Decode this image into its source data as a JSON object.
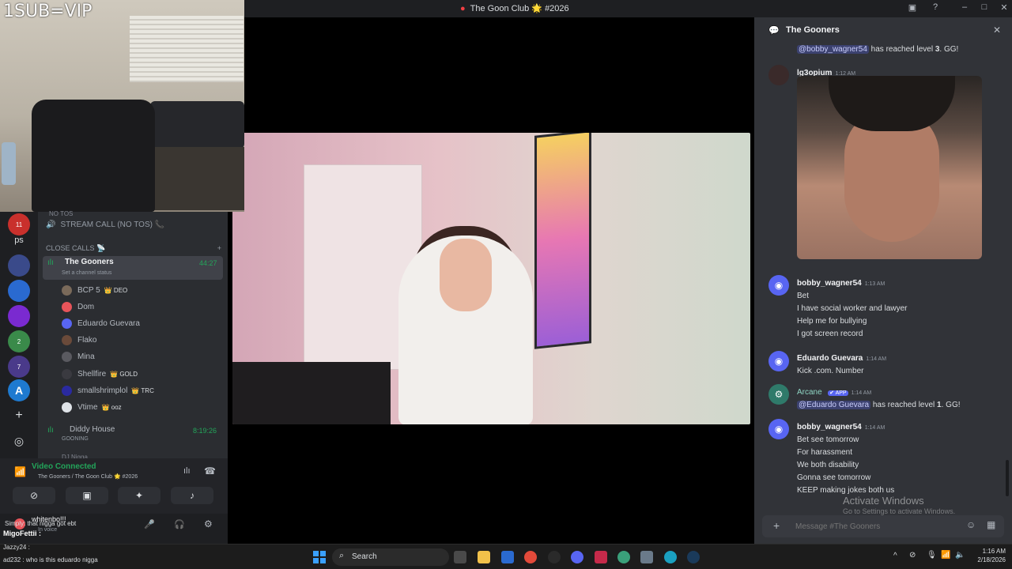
{
  "titlebar": {
    "title": "The Goon Club 🌟 #2026",
    "icons": [
      "inbox-icon",
      "help-icon",
      "minimize-icon",
      "maximize-icon",
      "close-icon"
    ]
  },
  "webcam": {
    "overlay_text": "1SUB=VIP"
  },
  "rail": {
    "label": "ps",
    "badges": [
      "11",
      "2",
      "7"
    ]
  },
  "channels": {
    "top_cut": "NO TOS",
    "stream_call": "STREAM CALL (NO TOS) 📞",
    "category": "CLOSE CALLS 📡",
    "active_channel": {
      "name": "The Gooners",
      "status": "Set a channel status",
      "timer": "44:27"
    },
    "users": [
      {
        "name": "BCP 5",
        "badge": "👑 DEO",
        "color": "#7a6a5a"
      },
      {
        "name": "Dom",
        "badge": "",
        "color": "#e8545a"
      },
      {
        "name": "Eduardo Guevara",
        "badge": "",
        "color": "#5865f2"
      },
      {
        "name": "Flako",
        "badge": "",
        "color": "#6a4a3a"
      },
      {
        "name": "Mina",
        "badge": "",
        "color": "#5a5a60"
      },
      {
        "name": "Shellfire",
        "badge": "👑 GOLD",
        "color": "#3a3a40"
      },
      {
        "name": "smallshrimplol",
        "badge": "👑 TRC",
        "color": "#2a2aa0"
      },
      {
        "name": "Vtime",
        "badge": "👑 ooz",
        "color": "#dfe3e8"
      }
    ],
    "second_channel": {
      "name": "Diddy House",
      "status": "GOONING",
      "timer": "8:19:26"
    },
    "cut_user": "DJ Nigga"
  },
  "voice": {
    "status": "Video Connected",
    "location": "The Gooners / The Goon Club 🌟 #2026"
  },
  "userbar": {
    "overlay_line1": "whitenbo!!!",
    "overlay_line2": "Simply: that nigga got ebt",
    "overlay_line3": "MigoFettii :",
    "overlay_line4": "Jazzy24 :",
    "overlay_line5": "ad232 : who is this eduardo nigga",
    "status": "In voice"
  },
  "chat": {
    "channel": "The Gooners",
    "messages": [
      {
        "type": "system",
        "mention": "@bobby_wagner54",
        "text_before": "has reached level",
        "level": "3",
        "text_after": ". GG!"
      },
      {
        "author": "lg3opium",
        "time": "1:12 AM",
        "lines": []
      },
      {
        "author": "bobby_wagner54",
        "time": "1:13 AM",
        "lines": [
          "Bet",
          "I have social worker and lawyer",
          "Help me for bullying",
          "I got screen record"
        ]
      },
      {
        "author": "Eduardo Guevara",
        "time": "1:14 AM",
        "lines": [
          "Kick .com.  Number"
        ]
      },
      {
        "author": "Arcane",
        "app_tag": "✔ APP",
        "time": "1:14 AM",
        "mention": "@Eduardo Guevara",
        "text_before": "has reached level",
        "level": "1",
        "text_after": ". GG!"
      },
      {
        "author": "bobby_wagner54",
        "time": "1:14 AM",
        "lines": [
          "Bet see tomorrow",
          "For harassment",
          "We both disability",
          "Gonna see tomorrow",
          "KEEP making jokes both us"
        ]
      }
    ],
    "input_placeholder": "Message #The Gooners",
    "watermark_title": "Activate Windows",
    "watermark_sub": "Go to Settings to activate Windows."
  },
  "taskbar": {
    "search_label": "Search",
    "time": "1:16 AM",
    "date": "2/18/2026"
  },
  "colors": {
    "discord_blurple": "#5865f2",
    "voice_green": "#23a55a",
    "background_dark": "#313338"
  }
}
